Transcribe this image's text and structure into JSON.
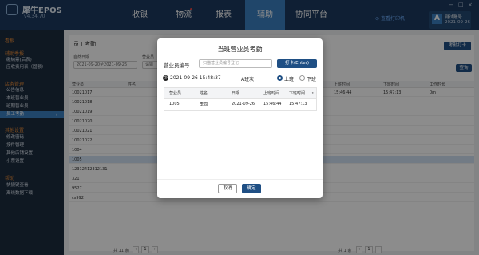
{
  "app": {
    "name": "犀牛EPOS",
    "version": "v4.34.70"
  },
  "nav": {
    "items": [
      "收银",
      "物流",
      "报表",
      "辅助",
      "协同平台"
    ],
    "active_index": 3
  },
  "topbar": {
    "view_print_label": "查看打印机",
    "account_name": "测试账号",
    "account_date": "2021-09-26",
    "account_badge": "A"
  },
  "window_controls": [
    "−",
    "□",
    "×"
  ],
  "sidebar": {
    "sections": [
      {
        "heading": "看板",
        "items": []
      },
      {
        "heading": "辅助季报",
        "items": [
          "缴纳票(后表)",
          "应收费用表（固额）"
        ]
      },
      {
        "heading": "店务管理",
        "items": [
          "公告信息",
          "本班营业员",
          "班期营业员",
          "员工考勤"
        ]
      },
      {
        "heading": "其他设置",
        "items": [
          "修改密码",
          "按件管理",
          "其他店铺设置",
          "小票设置"
        ]
      },
      {
        "heading": "帮助",
        "items": [
          "快捷键查看",
          "离线数据下载"
        ]
      }
    ],
    "active_item": "员工考勤"
  },
  "panel": {
    "title": "员工考勤",
    "clock_in_button": "考勤打卡",
    "date_label": "自然日期",
    "date_value": "2021-09-20至2021-09-26",
    "staff_label": "营业员",
    "staff_placeholder": "请输",
    "query_button": "查询",
    "columns": [
      "营业员",
      "姓名",
      "上班时间",
      "下班时间",
      "工作时长"
    ],
    "rows": [
      {
        "id": "10021017"
      },
      {
        "id": "10021018"
      },
      {
        "id": "10021019"
      },
      {
        "id": "10021020"
      },
      {
        "id": "10021021"
      },
      {
        "id": "10021022"
      },
      {
        "id": "1004"
      },
      {
        "id": "1005"
      },
      {
        "id": "12312412312131"
      },
      {
        "id": "321"
      },
      {
        "id": "9527"
      },
      {
        "id": "cs992"
      }
    ],
    "selected_row": 7,
    "right_columns": [
      "上班时间",
      "下班时间",
      "工作时长"
    ],
    "right_row": {
      "start": "15:46:44",
      "end": "15:47:13",
      "duration": "0m"
    },
    "left_pager": {
      "total": "共 11 条",
      "page": "1"
    },
    "right_pager": {
      "total": "共 1 条",
      "page": "1"
    }
  },
  "modal": {
    "title": "当班营业员考勤",
    "id_label": "营业员编号",
    "id_placeholder": "扫描营业员编号登记",
    "punch_button": "打卡(Enter)",
    "datetime": "2021-09-26 15:48:37",
    "shift": "A班次",
    "radio_on": "上班",
    "radio_off": "下班",
    "table": {
      "columns": [
        "营业员",
        "姓名",
        "日期",
        "上班时间",
        "下班时间"
      ],
      "row": {
        "id": "1005",
        "name": "李四",
        "date": "2021-09-26",
        "start": "15:46:44",
        "end": "15:47:13"
      }
    },
    "cancel_button": "取消",
    "ok_button": "确定"
  },
  "colors": {
    "topbar": "#1d3a5f",
    "sidebar": "#1d2c3f",
    "accent": "#3b80c2",
    "primary_button": "#1f4f84",
    "section_heading": "#e58b3a"
  }
}
